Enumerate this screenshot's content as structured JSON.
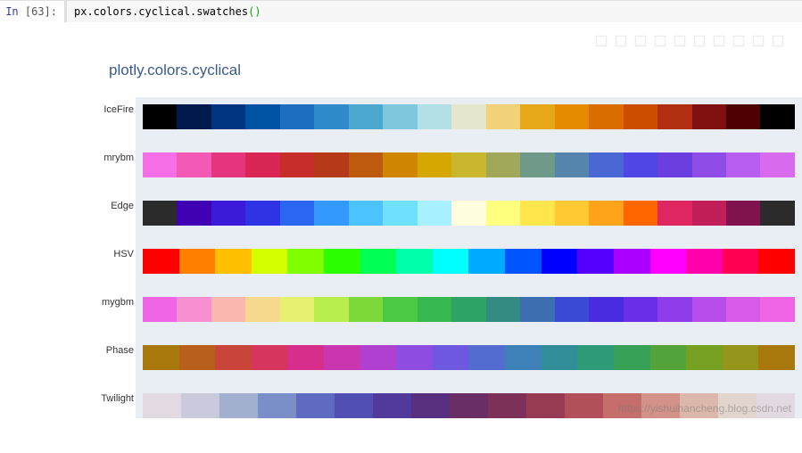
{
  "cell": {
    "prompt_label": "In",
    "prompt_num": "[63]:",
    "code_prefix": "px.colors.cyclical.",
    "code_call": "swatches",
    "code_paren_open": "(",
    "code_paren_close": ")"
  },
  "toolbar": {
    "icons": [
      "camera-icon",
      "zoom-icon",
      "pan-icon",
      "select-icon",
      "lasso-icon",
      "zoomin-icon",
      "zoomout-icon",
      "autoscale-icon",
      "reset-icon",
      "logo-icon"
    ]
  },
  "chart_data": {
    "type": "table",
    "title": "plotly.colors.cyclical",
    "series": [
      {
        "name": "IceFire",
        "values": [
          "#000000",
          "#001a4d",
          "#003380",
          "#0052a3",
          "#1d6ec1",
          "#2f8bc9",
          "#4aa8cf",
          "#7fc7dc",
          "#b3e0e6",
          "#e6e6cc",
          "#f2d279",
          "#e6a817",
          "#e68a00",
          "#d96d00",
          "#cc4c00",
          "#b22e10",
          "#801010",
          "#4d0000",
          "#000000"
        ]
      },
      {
        "name": "mrybm",
        "values": [
          "#f76fe6",
          "#f25ab5",
          "#e5357e",
          "#d92654",
          "#c72e2a",
          "#b43a1a",
          "#bd5a0e",
          "#d08600",
          "#d6a700",
          "#c9b72e",
          "#a1a85a",
          "#6f9a8a",
          "#5585ab",
          "#4a68d4",
          "#4f46e5",
          "#6b3ee0",
          "#8f4de8",
          "#b75ef0",
          "#d86aed"
        ]
      },
      {
        "name": "Edge",
        "values": [
          "#2b2b2b",
          "#4000b3",
          "#3d19d9",
          "#2e33e6",
          "#2a66f2",
          "#3399ff",
          "#4cc2ff",
          "#70e0ff",
          "#a6f0ff",
          "#ffffe0",
          "#ffff80",
          "#ffe64d",
          "#ffc933",
          "#ffa31a",
          "#ff6600",
          "#e02660",
          "#c21e5a",
          "#80134d",
          "#2b2b2b"
        ]
      },
      {
        "name": "HSV",
        "values": [
          "#ff0000",
          "#ff8000",
          "#ffbf00",
          "#d4ff00",
          "#80ff00",
          "#2bff00",
          "#00ff55",
          "#00ffaa",
          "#00ffff",
          "#00aaff",
          "#0055ff",
          "#0000ff",
          "#5500ff",
          "#aa00ff",
          "#ff00ff",
          "#ff00aa",
          "#ff0055",
          "#ff0000"
        ]
      },
      {
        "name": "mygbm",
        "values": [
          "#f065e6",
          "#f78fd0",
          "#f9b7b0",
          "#f7da8e",
          "#e8f071",
          "#b8ef4d",
          "#7dd93a",
          "#4cc943",
          "#34b84f",
          "#2fa266",
          "#338a80",
          "#3d6eb0",
          "#3b4ad2",
          "#4a2ce0",
          "#6a2ee8",
          "#8f3cea",
          "#b84ceb",
          "#d85be8",
          "#f065e6"
        ]
      },
      {
        "name": "Phase",
        "values": [
          "#a8780d",
          "#b85f1e",
          "#c94539",
          "#d6355e",
          "#d62e8a",
          "#c936b0",
          "#b040d0",
          "#8f4ce0",
          "#6e58e0",
          "#546cd0",
          "#3e80b8",
          "#328f99",
          "#2e9a78",
          "#37a157",
          "#54a33a",
          "#76a021",
          "#94951a",
          "#a8780d"
        ]
      },
      {
        "name": "Twilight",
        "values": [
          "#e2d9e2",
          "#c9cadb",
          "#a1b0ce",
          "#7a8fc8",
          "#5e6bc0",
          "#524fb3",
          "#513a9c",
          "#59307f",
          "#6a2e66",
          "#7d3158",
          "#973b52",
          "#b15058",
          "#c56e6b",
          "#d39289",
          "#dcb7ab",
          "#e2d5cd",
          "#e2d9e2"
        ]
      }
    ]
  },
  "watermark": "https://yishuihancheng.blog.csdn.net"
}
